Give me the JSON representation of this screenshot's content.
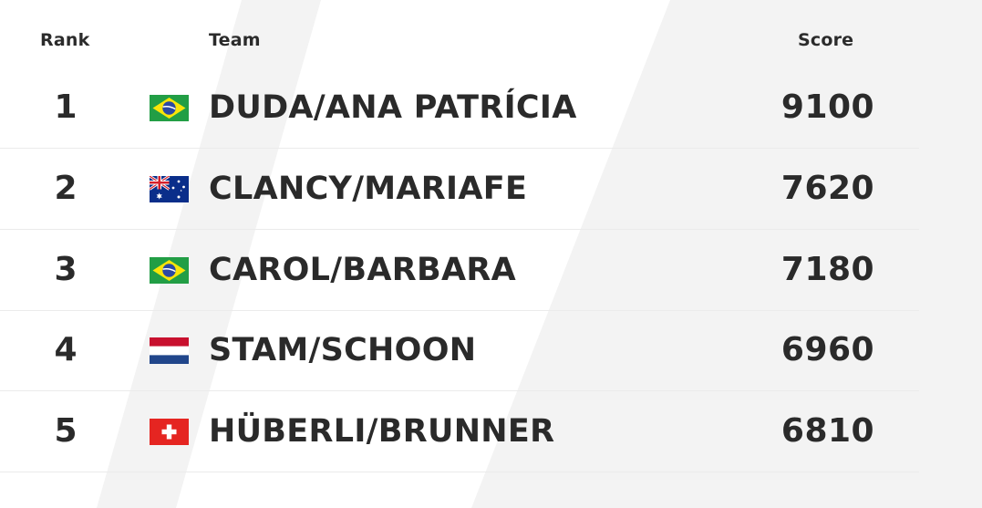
{
  "header": {
    "rank_label": "Rank",
    "team_label": "Team",
    "score_label": "Score"
  },
  "rows": [
    {
      "rank": "1",
      "team": "DUDA/ANA PATRÍCIA",
      "score": "9100",
      "flag": "brazil-flag-icon"
    },
    {
      "rank": "2",
      "team": "CLANCY/MARIAFE",
      "score": "7620",
      "flag": "australia-flag-icon"
    },
    {
      "rank": "3",
      "team": "CAROL/BARBARA",
      "score": "7180",
      "flag": "brazil-flag-icon"
    },
    {
      "rank": "4",
      "team": "STAM/SCHOON",
      "score": "6960",
      "flag": "netherlands-flag-icon"
    },
    {
      "rank": "5",
      "team": "HÜBERLI/BRUNNER",
      "score": "6810",
      "flag": "switzerland-flag-icon"
    }
  ],
  "colors": {
    "text": "#2a2a2a",
    "divider": "#ebebeb",
    "background_stripe": "#f2f2f2"
  }
}
